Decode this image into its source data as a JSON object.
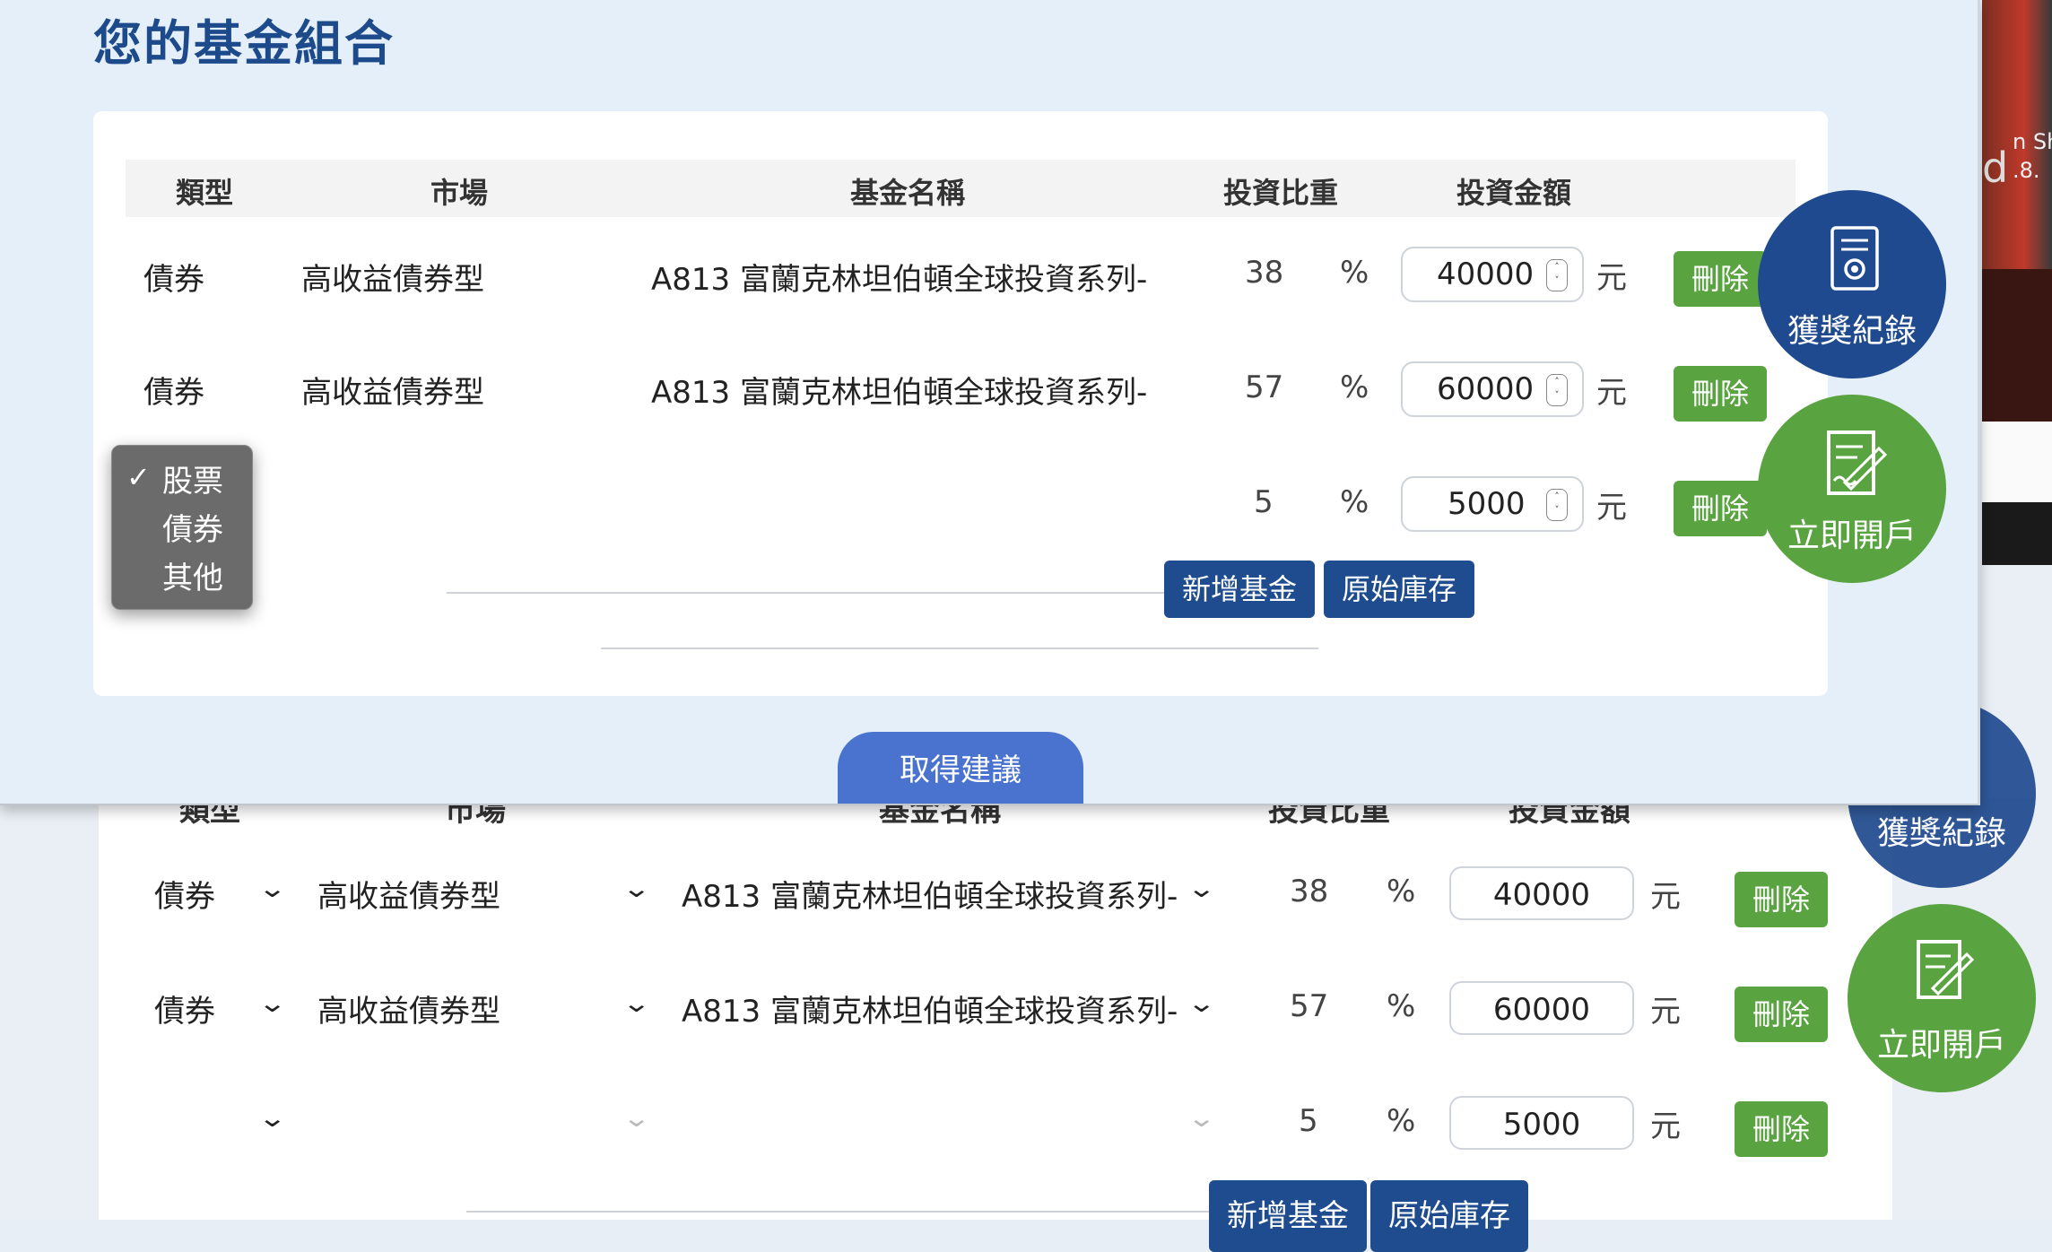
{
  "window": {
    "title": "您的基金組合"
  },
  "table": {
    "headers": [
      "類型",
      "市場",
      "基金名稱",
      "投資比重",
      "投資金額"
    ],
    "rows": [
      {
        "type": "債券",
        "market": "高收益債券型",
        "fund": "A813 富蘭克林坦伯頓全球投資系列-",
        "weight": "38",
        "pct": "%",
        "amount": "40000",
        "unit": "元",
        "delete": "刪除"
      },
      {
        "type": "債券",
        "market": "高收益債券型",
        "fund": "A813 富蘭克林坦伯頓全球投資系列-",
        "weight": "57",
        "pct": "%",
        "amount": "60000",
        "unit": "元",
        "delete": "刪除"
      },
      {
        "type": "",
        "market": "",
        "fund": "",
        "weight": "5",
        "pct": "%",
        "amount": "5000",
        "unit": "元",
        "delete": "刪除"
      }
    ],
    "add_fund": "新增基金",
    "original_stock": "原始庫存"
  },
  "dropdown": {
    "options": [
      "股票",
      "債券",
      "其他"
    ],
    "selected": "股票",
    "checkmark": "✓"
  },
  "get_advice": "取得建議",
  "floating": {
    "awards": "獲獎紀錄",
    "open_account": "立即開戶"
  },
  "background_page": {
    "headers": [
      "類型",
      "市場",
      "基金名稱",
      "投資比重",
      "投資金額"
    ],
    "rows": [
      {
        "type": "債券",
        "market": "高收益債券型",
        "fund": "A813 富蘭克林坦伯頓全球投資系列-",
        "weight": "38",
        "pct": "%",
        "amount": "40000",
        "unit": "元",
        "delete": "刪除"
      },
      {
        "type": "債券",
        "market": "高收益債券型",
        "fund": "A813 富蘭克林坦伯頓全球投資系列-",
        "weight": "57",
        "pct": "%",
        "amount": "60000",
        "unit": "元",
        "delete": "刪除"
      },
      {
        "type": "",
        "market": "",
        "fund": "",
        "weight": "5",
        "pct": "%",
        "amount": "5000",
        "unit": "元",
        "delete": "刪除"
      }
    ],
    "add_fund": "新增基金",
    "original_stock": "原始庫存",
    "awards": "獲獎紀錄",
    "open_account": "立即開戶"
  },
  "side_app": {
    "text1": "n Sh",
    "text2": "d",
    "text3": ".8."
  },
  "colors": {
    "primary_blue": "#1e4c8f",
    "button_green": "#5aa341",
    "advice_blue": "#4a72cf",
    "circle_blue": "#1f4a8f",
    "circle_green": "#5aa341"
  }
}
